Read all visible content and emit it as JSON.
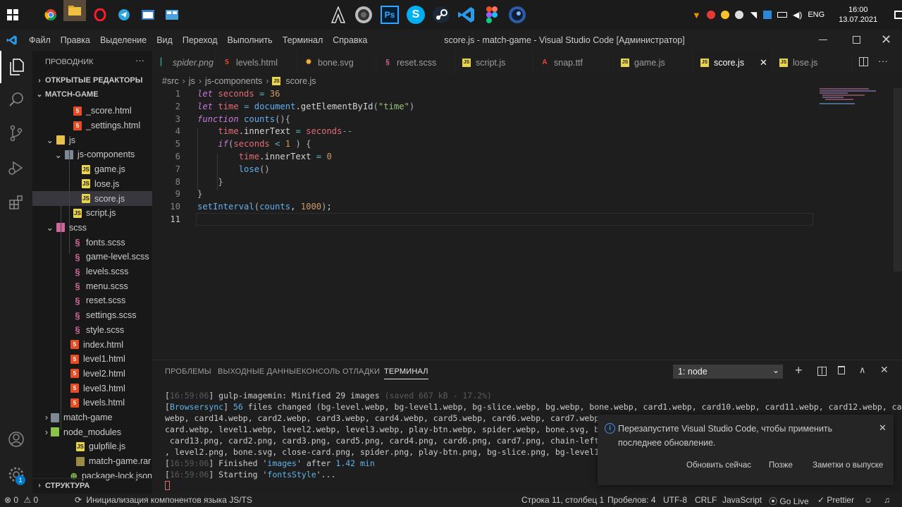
{
  "taskbar": {
    "apps": [
      "chrome",
      "file-explorer",
      "opera",
      "telegram",
      "browser",
      "monitor",
      "assassins-creed",
      "speaker",
      "photoshop",
      "skype",
      "steam",
      "vscode",
      "figma",
      "cinema4d"
    ],
    "lang": "ENG",
    "time": "16:00",
    "date": "13.07.2021"
  },
  "titlebar": {
    "menu": [
      "Файл",
      "Правка",
      "Выделение",
      "Вид",
      "Переход",
      "Выполнить",
      "Терминал",
      "Справка"
    ],
    "title": "score.js - match-game - Visual Studio Code [Администратор]"
  },
  "sidebar": {
    "title": "ПРОВОДНИК",
    "open_editors": "ОТКРЫТЫЕ РЕДАКТОРЫ",
    "project": "MATCH-GAME",
    "tree": [
      {
        "label": "_score.html",
        "icon": "html"
      },
      {
        "label": "_settings.html",
        "icon": "html"
      },
      {
        "label": "js",
        "icon": "folder-js"
      },
      {
        "label": "js-components",
        "icon": "folder"
      },
      {
        "label": "game.js",
        "icon": "js"
      },
      {
        "label": "lose.js",
        "icon": "js"
      },
      {
        "label": "score.js",
        "icon": "js"
      },
      {
        "label": "script.js",
        "icon": "js"
      },
      {
        "label": "scss",
        "icon": "folder-scss"
      },
      {
        "label": "fonts.scss",
        "icon": "scss"
      },
      {
        "label": "game-level.scss",
        "icon": "scss"
      },
      {
        "label": "levels.scss",
        "icon": "scss"
      },
      {
        "label": "menu.scss",
        "icon": "scss"
      },
      {
        "label": "reset.scss",
        "icon": "scss"
      },
      {
        "label": "settings.scss",
        "icon": "scss"
      },
      {
        "label": "style.scss",
        "icon": "scss"
      },
      {
        "label": "index.html",
        "icon": "html"
      },
      {
        "label": "level1.html",
        "icon": "html"
      },
      {
        "label": "level2.html",
        "icon": "html"
      },
      {
        "label": "level3.html",
        "icon": "html"
      },
      {
        "label": "levels.html",
        "icon": "html"
      },
      {
        "label": "match-game",
        "icon": "folder-gen"
      },
      {
        "label": "node_modules",
        "icon": "folder-node"
      },
      {
        "label": "gulpfile.js",
        "icon": "js"
      },
      {
        "label": "match-game.rar",
        "icon": "rar"
      },
      {
        "label": "package-lock.json",
        "icon": "lock"
      }
    ],
    "outline": "СТРУКТУРА"
  },
  "tabs": [
    {
      "label": "spider.png",
      "icon": "image"
    },
    {
      "label": "levels.html",
      "icon": "html"
    },
    {
      "label": "bone.svg",
      "icon": "svg"
    },
    {
      "label": "reset.scss",
      "icon": "scss"
    },
    {
      "label": "script.js",
      "icon": "js"
    },
    {
      "label": "snap.ttf",
      "icon": "font"
    },
    {
      "label": "game.js",
      "icon": "js"
    },
    {
      "label": "score.js",
      "icon": "js",
      "active": true
    },
    {
      "label": "lose.js",
      "icon": "js"
    }
  ],
  "breadcrumb": [
    "#src",
    "js",
    "js-components",
    "score.js"
  ],
  "editor": {
    "line_numbers": [
      "1",
      "2",
      "3",
      "4",
      "5",
      "6",
      "7",
      "8",
      "9",
      "10",
      "11"
    ],
    "lines": [
      "let seconds = 36",
      "let time = document.getElementById(\"time\")",
      "function counts(){",
      "    time.innerText = seconds--",
      "    if(seconds < 1 ) {",
      "        time.innerText = 0",
      "        lose()",
      "    }",
      "}",
      "setInterval(counts, 1000);",
      ""
    ]
  },
  "panel": {
    "tabs": [
      "ПРОБЛЕМЫ",
      "ВЫХОДНЫЕ ДАННЫЕ",
      "КОНСОЛЬ ОТЛАДКИ",
      "ТЕРМИНАЛ"
    ],
    "terminal_select": "1: node",
    "terminal_lines": [
      "[16:59:06] gulp-imagemin: Minified 29 images (saved 667 kB - 17.2%)",
      "[Browsersync] 56 files changed (bg-level.webp, bg-level1.webp, bg-slice.webp, bg.webp, bone.webp, card1.webp, card10.webp, card11.webp, card12.webp, card13.",
      "webp, card14.webp, card2.webp, card3.webp, card4.webp, card5.webp, card6.webp, card7.webp, ca",
      "card.webp, level1.webp, level2.webp, level3.webp, play-btn.webp, spider.webp, bone.svg, bone.",
      " card13.png, card2.png, card3.png, card5.png, card4.png, card6.png, card7.png, chain-left.png,",
      ", level2.png, bone.svg, close-card.png, spider.png, play-btn.png, bg-slice.png, bg-level1.png",
      "[16:59:06] Finished 'images' after 1.42 min",
      "[16:59:06] Starting 'fontsStyle'..."
    ]
  },
  "notification": {
    "message": "Перезапустите Visual Studio Code, чтобы применить последнее обновление.",
    "actions": [
      "Обновить сейчас",
      "Позже",
      "Заметки о выпуске"
    ]
  },
  "statusbar": {
    "errors": "0",
    "warnings": "0",
    "task": "Инициализация компонентов языка JS/TS",
    "position": "Строка 11, столбец 1",
    "spaces": "Пробелов: 4",
    "encoding": "UTF-8",
    "eol": "CRLF",
    "language": "JavaScript",
    "golive": "Go Live",
    "prettier": "Prettier",
    "settings_badge": "1"
  },
  "colors": {
    "accent": "#007acc",
    "bg": "#1e1e1e",
    "sidebar_bg": "#181818"
  }
}
